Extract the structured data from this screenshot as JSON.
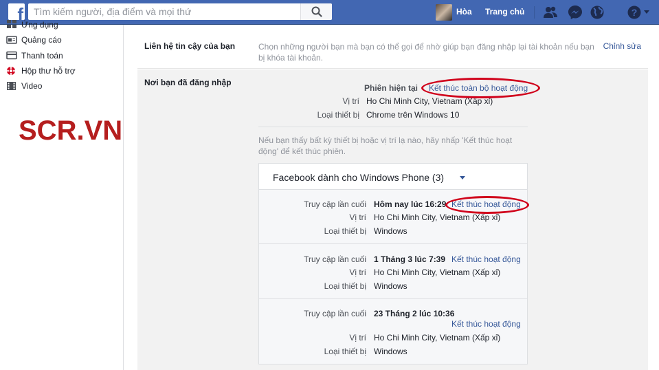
{
  "topbar": {
    "logo": "f",
    "search_placeholder": "Tìm kiếm người, địa điểm và mọi thứ",
    "user_name": "Hòa",
    "home": "Trang chủ",
    "icons": [
      "friends-icon",
      "messenger-icon",
      "globe-icon",
      "help-icon",
      "caret-down-icon"
    ]
  },
  "sidebar": {
    "items": [
      {
        "label": "Ứng dụng",
        "icon": "apps-icon"
      },
      {
        "label": "Quảng cáo",
        "icon": "ads-icon"
      },
      {
        "label": "Thanh toán",
        "icon": "payments-icon"
      },
      {
        "label": "Hộp thư hỗ trợ",
        "icon": "support-inbox-icon"
      },
      {
        "label": "Video",
        "icon": "video-icon"
      }
    ]
  },
  "watermark": "SCR.VN",
  "trusted_contacts": {
    "label": "Liên hệ tin cậy của bạn",
    "description": "Chọn những người bạn mà bạn có thể gọi để nhờ giúp bạn đăng nhập lại tài khoản nếu bạn bị khóa tài khoản.",
    "edit": "Chỉnh sửa"
  },
  "logged_in": {
    "label": "Nơi bạn đã đăng nhập",
    "current": {
      "session_label": "Phiên hiện tại",
      "end_all": "Kết thúc toàn bộ hoạt động",
      "location_label": "Vị trí",
      "location": "Ho Chi Minh City, Vietnam (Xấp xỉ)",
      "device_label": "Loại thiết bị",
      "device": "Chrome trên Windows 10"
    },
    "note": "Nếu bạn thấy bất kỳ thiết bị hoặc vị trí lạ nào, hãy nhấp 'Kết thúc hoạt động' để kết thúc phiên.",
    "app": {
      "title": "Facebook dành cho Windows Phone (3)",
      "sessions": [
        {
          "last_access_label": "Truy cập lần cuối",
          "last_access": "Hôm nay lúc 16:29",
          "end": "Kết thúc hoạt động",
          "location_label": "Vị trí",
          "location": "Ho Chi Minh City, Vietnam (Xấp xỉ)",
          "device_label": "Loại thiết bị",
          "device": "Windows"
        },
        {
          "last_access_label": "Truy cập lần cuối",
          "last_access": "1 Tháng 3 lúc 7:39",
          "end": "Kết thúc hoạt động",
          "location_label": "Vị trí",
          "location": "Ho Chi Minh City, Vietnam (Xấp xỉ)",
          "device_label": "Loại thiết bị",
          "device": "Windows"
        },
        {
          "last_access_label": "Truy cập lần cuối",
          "last_access": "23 Tháng 2 lúc 10:36",
          "end": "Kết thúc hoạt động",
          "location_label": "Vị trí",
          "location": "Ho Chi Minh City, Vietnam (Xấp xỉ)",
          "device_label": "Loại thiết bị",
          "device": "Windows"
        }
      ]
    }
  },
  "colors": {
    "topbar": "#4267b2",
    "link": "#365899",
    "annotation": "#d0021b",
    "watermark": "#b51e1e"
  }
}
